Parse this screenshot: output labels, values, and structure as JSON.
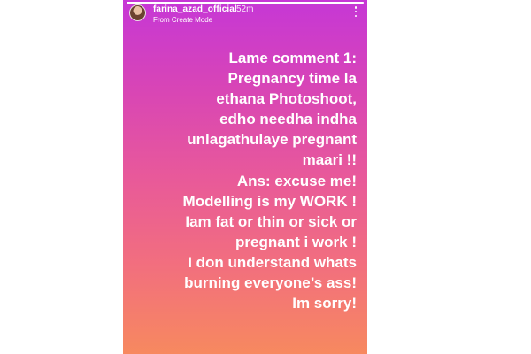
{
  "story": {
    "username": "farina_azad_official",
    "time_ago": "52m",
    "subtitle": "From Create Mode",
    "progress": 1.0,
    "background_gradient": [
      "#c637d6",
      "#d845b6",
      "#e8599a",
      "#f26f7e",
      "#f7895f"
    ],
    "text_color": "#ffffff",
    "icons": {
      "avatar": "profile-avatar",
      "menu": "more-vertical-icon"
    },
    "caption_lines": [
      "Lame comment 1:",
      "Pregnancy time la",
      "ethana Photoshoot,",
      "edho needha indha",
      "unlagathulaye pregnant",
      "maari !!",
      "Ans: excuse me!",
      "Modelling is my WORK !",
      "Iam fat or thin or sick or",
      "pregnant i work !",
      "I don understand whats",
      "burning everyone’s ass!",
      "Im sorry!"
    ]
  }
}
